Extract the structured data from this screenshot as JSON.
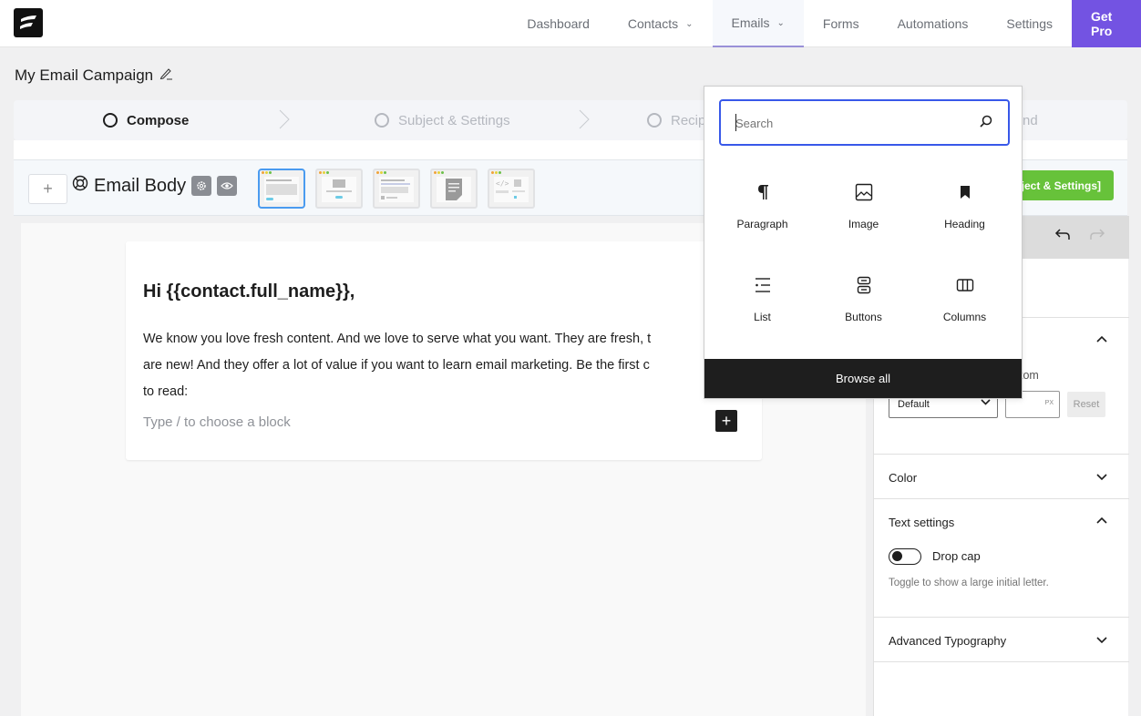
{
  "nav": {
    "items": [
      {
        "label": "Dashboard",
        "dropdown": false,
        "active": false
      },
      {
        "label": "Contacts",
        "dropdown": true,
        "active": false
      },
      {
        "label": "Emails",
        "dropdown": true,
        "active": true
      },
      {
        "label": "Forms",
        "dropdown": false,
        "active": false
      },
      {
        "label": "Automations",
        "dropdown": false,
        "active": false
      },
      {
        "label": "Settings",
        "dropdown": false,
        "active": false
      }
    ],
    "cta": "Get Pro",
    "cta_color": "#7353e2"
  },
  "campaign": {
    "title": "My Email Campaign",
    "edit_icon": "pencil-icon"
  },
  "steps": [
    {
      "label": "Compose",
      "active": true
    },
    {
      "label": "Subject & Settings",
      "active": false
    },
    {
      "label": "Recipients",
      "active": false,
      "visible_text": "Recip"
    },
    {
      "label": "Send",
      "active": false,
      "visible_text": "nd"
    }
  ],
  "body_bar": {
    "add_label": "+",
    "title": "Email Body",
    "title_icon": "lifebuoy-icon",
    "settings_icon": "gear-icon",
    "preview_icon": "eye-icon",
    "templates": [
      {
        "name": "plain-text",
        "selected": true
      },
      {
        "name": "image-banner",
        "selected": false
      },
      {
        "name": "text-with-footer",
        "selected": false
      },
      {
        "name": "document",
        "selected": false
      },
      {
        "name": "code-html",
        "selected": false
      }
    ],
    "next_button": "[Next: Subject & Settings]",
    "next_visible": "ject & Settings]",
    "next_color": "#67c23a"
  },
  "email": {
    "greeting": "Hi {{contact.full_name}},",
    "paragraph": "We know you love fresh content. And we love to serve what you want. They are fresh,  t are new! And they offer a lot of value if you want to learn email marketing. Be the first c to read:",
    "paragraph_lines": [
      "We know you love fresh content. And we love to serve what you want. They are fresh,  t",
      "are new! And they offer a lot of value if you want to learn email marketing. Be the first c",
      "to read:"
    ],
    "block_placeholder": "Type / to choose a block",
    "add_block_label": "+"
  },
  "inserter": {
    "search_placeholder": "Search",
    "blocks": [
      {
        "label": "Paragraph",
        "icon": "paragraph-icon"
      },
      {
        "label": "Image",
        "icon": "image-icon"
      },
      {
        "label": "Heading",
        "icon": "heading-bookmark-icon"
      },
      {
        "label": "List",
        "icon": "list-icon"
      },
      {
        "label": "Buttons",
        "icon": "buttons-icon"
      },
      {
        "label": "Columns",
        "icon": "columns-icon"
      }
    ],
    "browse_all": "Browse all"
  },
  "sidebar": {
    "undo": "↶",
    "redo": "↷",
    "typography": {
      "custom_label": "Custom",
      "custom_visible": "tom",
      "select_value": "Default",
      "px_unit": "PX",
      "px_value": "",
      "reset": "Reset"
    },
    "sections": [
      {
        "title": "Color",
        "expanded": false
      },
      {
        "title": "Text settings",
        "expanded": true
      },
      {
        "title": "Advanced Typography",
        "expanded": false
      }
    ],
    "drop_cap": {
      "label": "Drop cap",
      "enabled": false,
      "help": "Toggle to show a large initial letter."
    }
  }
}
